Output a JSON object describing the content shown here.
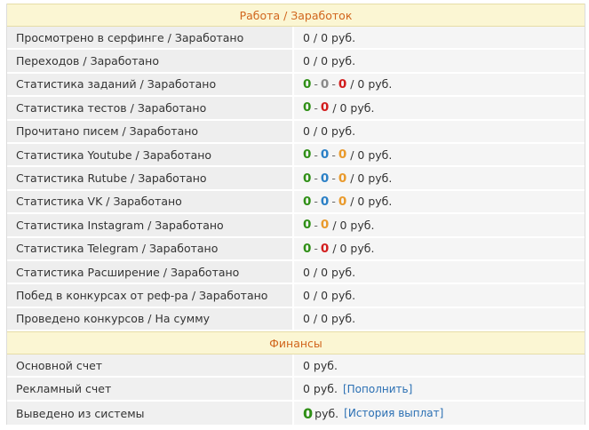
{
  "sections": {
    "work": {
      "title": "Работа / Заработок",
      "rows": [
        {
          "label": "Просмотрено в серфинге / Заработано",
          "value": "0 / 0 руб."
        },
        {
          "label": "Переходов / Заработано",
          "value": "0 / 0 руб."
        },
        {
          "label": "Статистика заданий / Заработано",
          "counts": [
            "0",
            "0",
            "0"
          ],
          "suffix": "/ 0 руб."
        },
        {
          "label": "Статистика тестов / Заработано",
          "counts": [
            "0",
            "0"
          ],
          "suffix": "/ 0 руб."
        },
        {
          "label": "Прочитано писем / Заработано",
          "value": "0 / 0 руб."
        },
        {
          "label": "Статистика Youtube / Заработано",
          "counts": [
            "0",
            "0",
            "0"
          ],
          "suffix": "/ 0 руб."
        },
        {
          "label": "Статистика Rutube / Заработано",
          "counts": [
            "0",
            "0",
            "0"
          ],
          "suffix": "/ 0 руб."
        },
        {
          "label": "Статистика VK / Заработано",
          "counts": [
            "0",
            "0",
            "0"
          ],
          "suffix": "/ 0 руб."
        },
        {
          "label": "Статистика Instagram / Заработано",
          "counts": [
            "0",
            "0"
          ],
          "suffix": "/ 0 руб."
        },
        {
          "label": "Статистика Telegram / Заработано",
          "counts": [
            "0",
            "0"
          ],
          "suffix": "/ 0 руб."
        },
        {
          "label": "Статистика Расширение / Заработано",
          "value": "0 / 0 руб."
        },
        {
          "label": "Побед в конкурсах от реф-ра / Заработано",
          "value": "0 / 0 руб."
        },
        {
          "label": "Проведено конкурсов / На сумму",
          "value": "0 / 0 руб."
        }
      ]
    },
    "finance": {
      "title": "Финансы",
      "rows": [
        {
          "label": "Основной счет",
          "value": "0 руб."
        },
        {
          "label": "Рекламный счет",
          "value": "0 руб.",
          "link": "[Пополнить]"
        },
        {
          "label": "Выведено из системы",
          "big": "0",
          "value": "руб.",
          "link": "[История выплат]"
        }
      ]
    }
  },
  "colors": {
    "header_bg": "#fbf6d3",
    "header_text": "#d1661d",
    "green": "#2f8f16",
    "gray": "#8a8a8a",
    "red": "#d21d1d",
    "blue": "#2b80c6",
    "orange": "#e99a2c",
    "link": "#2a6fb3"
  }
}
